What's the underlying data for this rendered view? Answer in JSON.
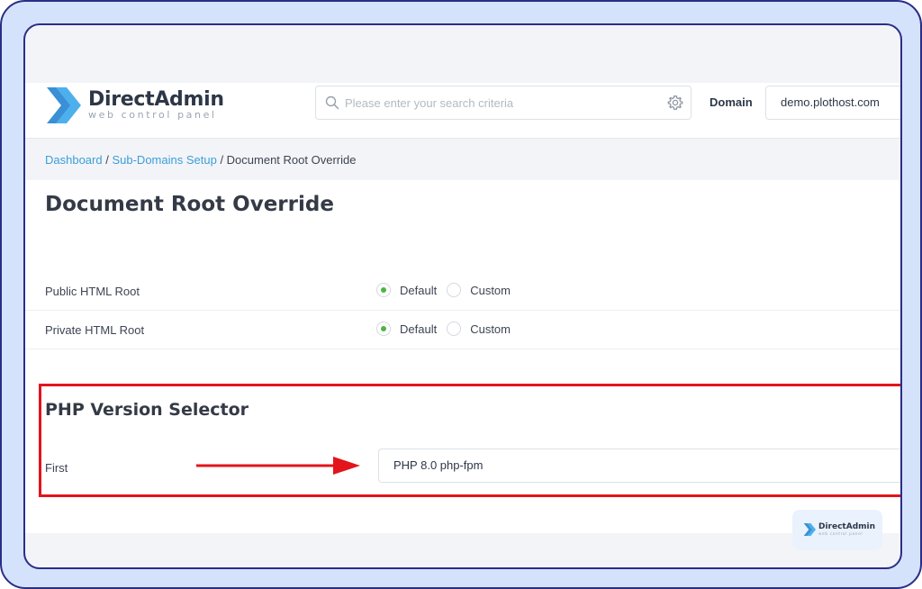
{
  "header": {
    "brand_name": "DirectAdmin",
    "brand_tagline": "web control panel",
    "search_placeholder": "Please enter your search criteria",
    "domain_label": "Domain",
    "domain_value": "demo.plothost.com"
  },
  "breadcrumb": {
    "items": [
      "Dashboard",
      "Sub-Domains Setup",
      "Document Root Override"
    ],
    "separator": "/"
  },
  "page": {
    "title": "Document Root Override"
  },
  "settings": [
    {
      "label": "Public HTML Root",
      "options": [
        "Default",
        "Custom"
      ],
      "selected": "Default"
    },
    {
      "label": "Private HTML Root",
      "options": [
        "Default",
        "Custom"
      ],
      "selected": "Default"
    }
  ],
  "php_section": {
    "title": "PHP Version Selector",
    "field_label": "First",
    "selected_value": "PHP 8.0 php-fpm"
  },
  "annotation": {
    "highlight_color": "#e3141b"
  },
  "colors": {
    "accent": "#3b9ed8",
    "radio_checked": "#4bb543",
    "frame_border": "#2a2e86",
    "frame_background": "#d4e3fb"
  },
  "icons": {
    "logo": "directadmin-chevrons-icon",
    "search": "search-icon",
    "search_settings": "gear-icon",
    "annotation": "arrow-right-icon"
  }
}
